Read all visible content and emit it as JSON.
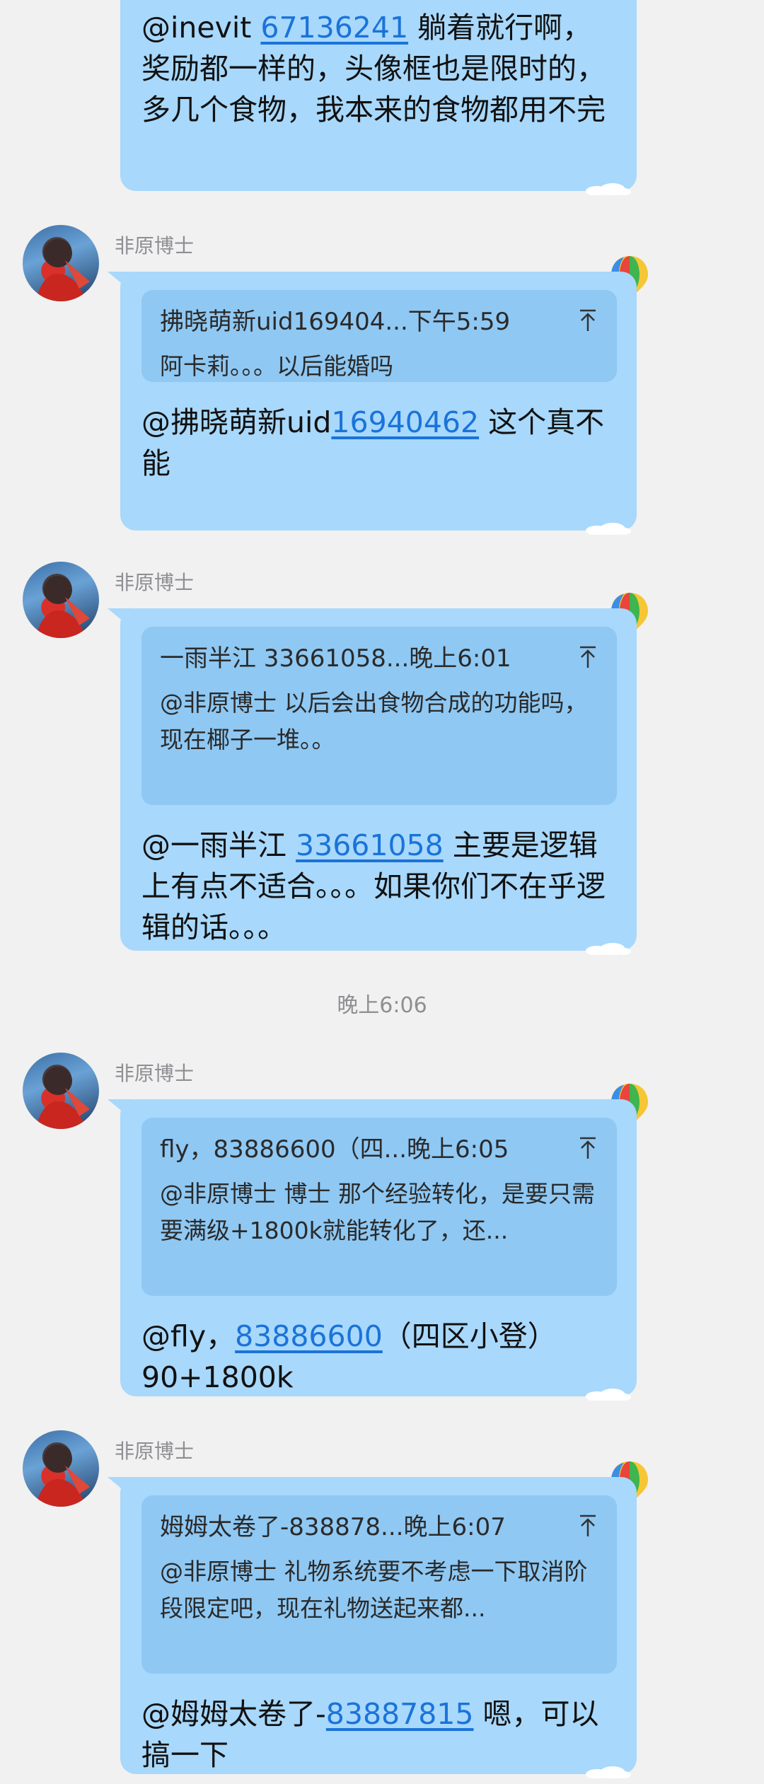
{
  "messages": [
    {
      "text_prefix": "@inevit ",
      "text_uid": "67136241",
      "text_suffix": " 躺着就行啊，奖励都一样的，头像框也是限时的，多几个食物，我本来的食物都用不完"
    },
    {
      "sender": "非原博士",
      "quote_head": "拂晓萌新uid169404...下午5:59",
      "quote_body": "阿卡莉。。。以后能婚吗",
      "text_prefix": "@拂晓萌新uid",
      "text_uid": "16940462",
      "text_suffix": " 这个真不能"
    },
    {
      "sender": "非原博士",
      "quote_head": "一雨半江  33661058...晚上6:01",
      "quote_body": "@非原博士 以后会出食物合成的功能吗，现在椰子一堆。。",
      "text_prefix": "@一雨半江  ",
      "text_uid": "33661058",
      "text_suffix": " 主要是逻辑上有点不适合。。。如果你们不在乎逻辑的话。。。"
    },
    {
      "sender": "非原博士",
      "quote_head": "fly，83886600（四...晚上6:05",
      "quote_body": "@非原博士 博士 那个经验转化，是要只需要满级+1800k就能转化了，还...",
      "text_prefix": "@fly，",
      "text_uid": "83886600",
      "text_suffix": "（四区小登）90+1800k"
    },
    {
      "sender": "非原博士",
      "quote_head": "姆姆太卷了-838878...晚上6:07",
      "quote_body": "@非原博士 礼物系统要不考虑一下取消阶段限定吧，现在礼物送起来都...",
      "text_prefix": "@姆姆太卷了-",
      "text_uid": "83887815",
      "text_suffix": " 嗯，可以搞一下"
    }
  ],
  "timestamp": "晚上6:06",
  "icons": {
    "avatar": "avatar-image",
    "balloon": "hot-air-balloon-icon",
    "quote_arrow": "jump-to-top-icon"
  },
  "colors": {
    "bubble": "#a8d8fb",
    "quote": "#8fc8f3",
    "link": "#1a73d9",
    "background": "#f1f1f1"
  }
}
